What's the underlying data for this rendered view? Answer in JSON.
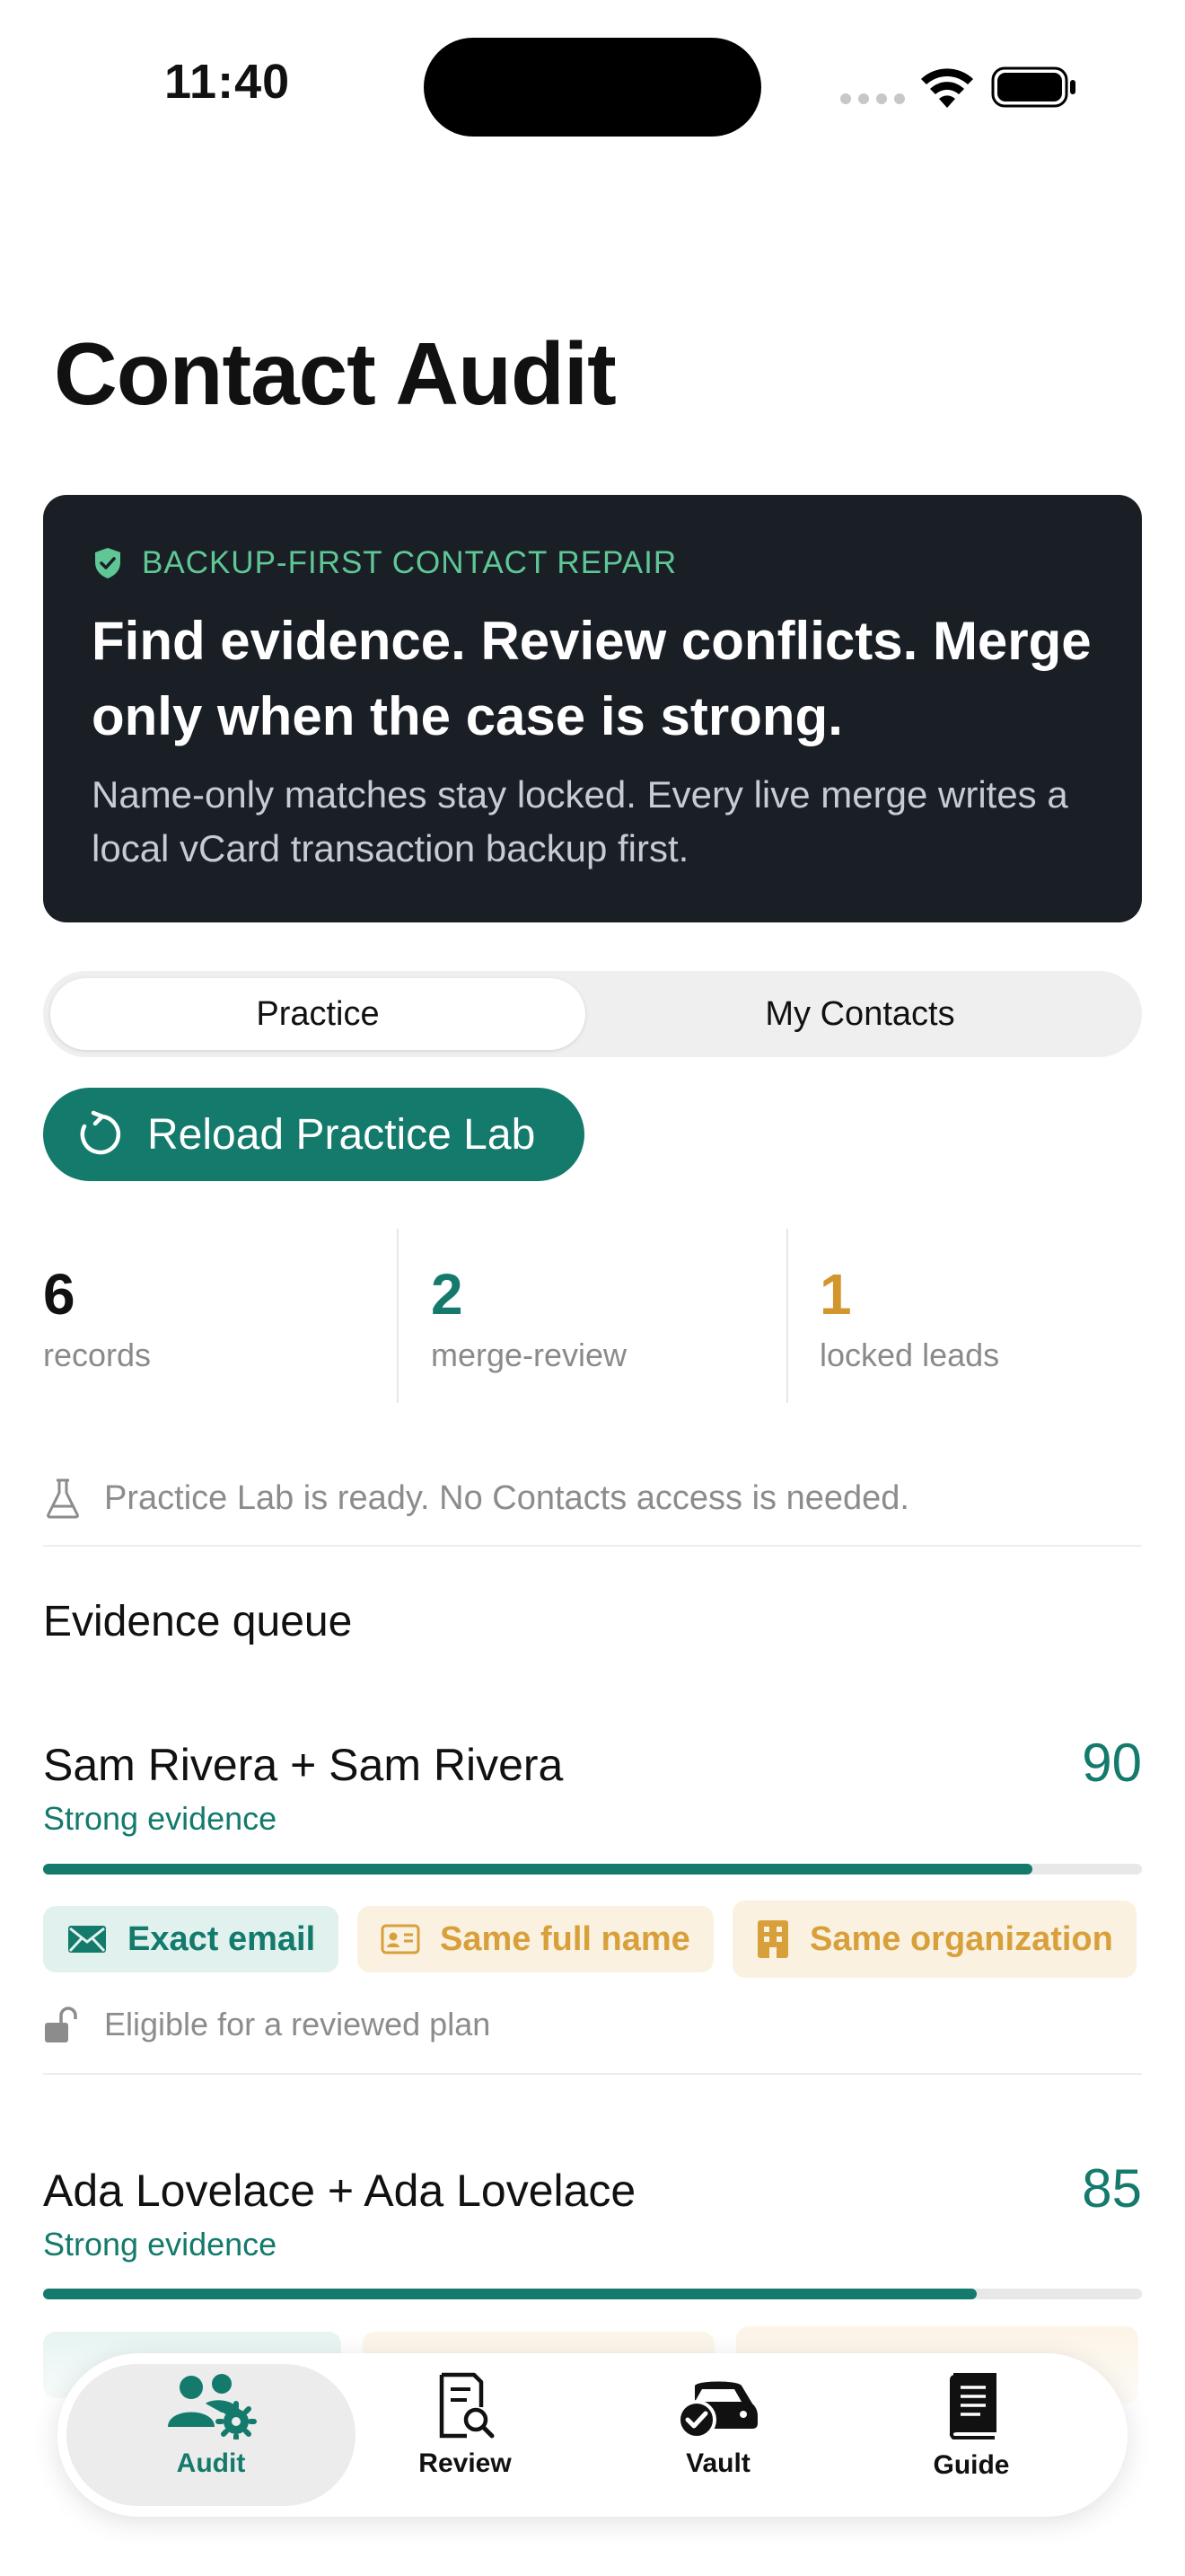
{
  "status_bar": {
    "time": "11:40"
  },
  "page_title": "Contact Audit",
  "hero": {
    "kicker": "BACKUP-FIRST CONTACT REPAIR",
    "headline": "Find evidence. Review conflicts. Merge only when the case is strong.",
    "subtitle": "Name-only matches stay locked. Every live merge writes a local vCard transaction backup first."
  },
  "segment": {
    "options": [
      "Practice",
      "My Contacts"
    ],
    "selected": "Practice"
  },
  "reload_button": "Reload Practice Lab",
  "stats": [
    {
      "value": "6",
      "label": "records",
      "color": "#111111"
    },
    {
      "value": "2",
      "label": "merge-review",
      "color": "#137a6c"
    },
    {
      "value": "1",
      "label": "locked leads",
      "color": "#d3962e"
    }
  ],
  "notice": "Practice Lab is ready. No Contacts access is needed.",
  "section_title": "Evidence queue",
  "queue": [
    {
      "pair": "Sam Rivera + Sam Rivera",
      "strength": "Strong evidence",
      "score": "90",
      "score_fraction": 0.9,
      "chips": [
        {
          "label": "Exact email",
          "icon": "envelope-icon",
          "tone": "green"
        },
        {
          "label": "Same full name",
          "icon": "id-card-icon",
          "tone": "amber"
        },
        {
          "label": "Same organization",
          "icon": "building-icon",
          "tone": "amber"
        }
      ],
      "eligibility": "Eligible for a reviewed plan"
    },
    {
      "pair": "Ada Lovelace + Ada Lovelace",
      "strength": "Strong evidence",
      "score": "85",
      "score_fraction": 0.85
    }
  ],
  "tabs": [
    {
      "label": "Audit",
      "icon": "people-gear-icon",
      "active": true
    },
    {
      "label": "Review",
      "icon": "document-search-icon",
      "active": false
    },
    {
      "label": "Vault",
      "icon": "vault-check-icon",
      "active": false
    },
    {
      "label": "Guide",
      "icon": "book-icon",
      "active": false
    }
  ],
  "colors": {
    "accent": "#137a6c",
    "amber": "#d8a03a",
    "hero_bg": "#1a1f26",
    "kicker": "#5fc796"
  }
}
